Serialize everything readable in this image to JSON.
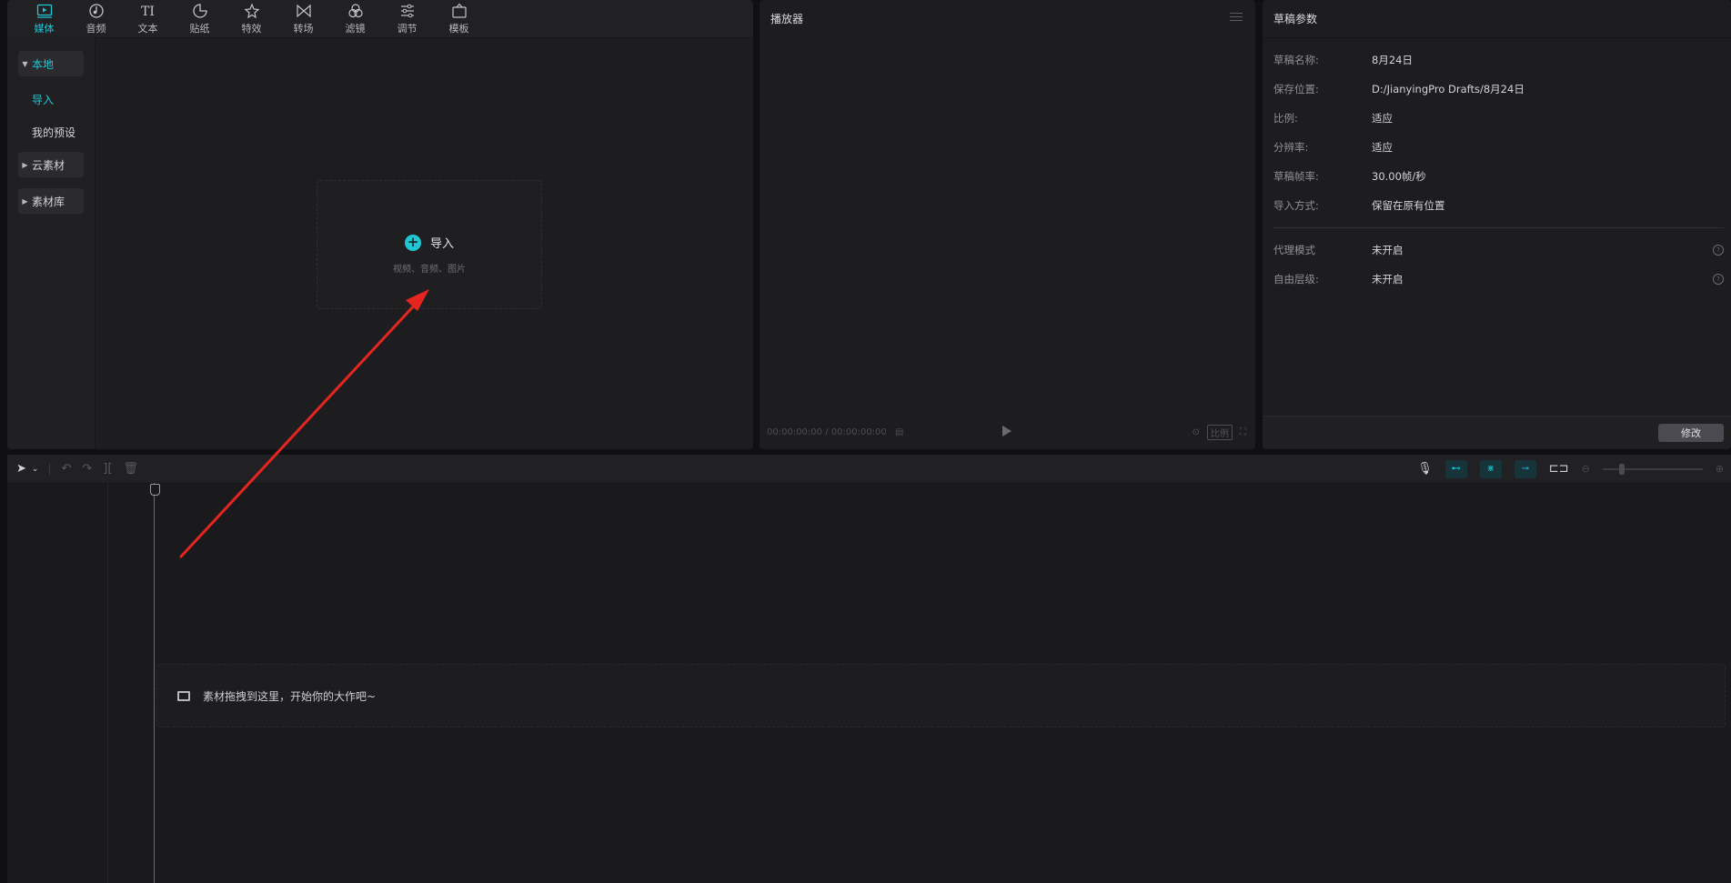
{
  "toolbar": {
    "tabs": [
      {
        "label": "媒体",
        "icon": "media-icon"
      },
      {
        "label": "音频",
        "icon": "audio-icon"
      },
      {
        "label": "文本",
        "icon": "text-icon"
      },
      {
        "label": "贴纸",
        "icon": "sticker-icon"
      },
      {
        "label": "特效",
        "icon": "effects-icon"
      },
      {
        "label": "转场",
        "icon": "transition-icon"
      },
      {
        "label": "滤镜",
        "icon": "filter-icon"
      },
      {
        "label": "调节",
        "icon": "adjust-icon"
      },
      {
        "label": "模板",
        "icon": "template-icon"
      }
    ],
    "active_tab": "媒体",
    "accent": "#1fc7d4"
  },
  "sidebar": {
    "items": [
      {
        "label": "本地"
      },
      {
        "label": "导入"
      },
      {
        "label": "我的预设"
      },
      {
        "label": "云素材"
      },
      {
        "label": "素材库"
      }
    ]
  },
  "import": {
    "label": "导入",
    "hint": "视频、音频、图片"
  },
  "player": {
    "title": "播放器",
    "current_time": "00:00:00:00",
    "separator": "/",
    "total_time": "00:00:00:00",
    "ratio_label": "比例"
  },
  "params": {
    "title": "草稿参数",
    "rows": [
      {
        "key": "草稿名称:",
        "value": "8月24日"
      },
      {
        "key": "保存位置:",
        "value": "D:/JianyingPro Drafts/8月24日"
      },
      {
        "key": "比例:",
        "value": "适应"
      },
      {
        "key": "分辨率:",
        "value": "适应"
      },
      {
        "key": "草稿帧率:",
        "value": "30.00帧/秒"
      },
      {
        "key": "导入方式:",
        "value": "保留在原有位置"
      },
      {
        "key": "代理模式",
        "value": "未开启"
      },
      {
        "key": "自由层级:",
        "value": "未开启"
      }
    ],
    "edit_label": "修改"
  },
  "timeline": {
    "drop_hint": "素材拖拽到这里，开始你的大作吧~"
  },
  "annotation_color": "#e62520"
}
